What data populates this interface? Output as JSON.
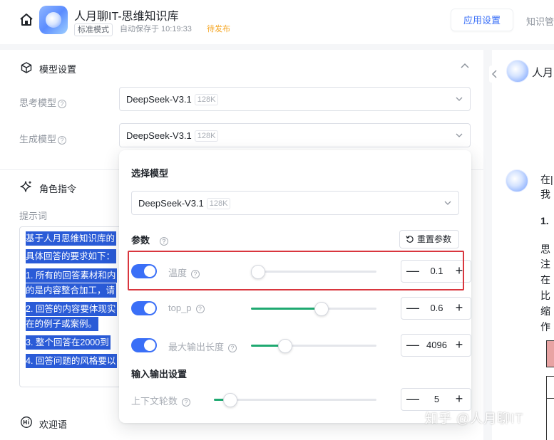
{
  "header": {
    "app_title": "人月聊IT-思维知识库",
    "tag_mode": "标准模式",
    "tag_autosave": "自动保存于 10:19:33",
    "tag_status": "待发布",
    "tab_app_settings": "应用设置",
    "tab_knowledge": "知识管"
  },
  "model_section": {
    "title": "模型设置",
    "think_label": "思考模型",
    "think_model": "DeepSeek-V3.1",
    "think_ctx": "128K",
    "gen_label": "生成模型",
    "gen_model": "DeepSeek-V3.1",
    "gen_ctx": "128K"
  },
  "role_section": {
    "title": "角色指令",
    "prompt_label": "提示词",
    "prompt_lines": [
      "基于人月思维知识库的",
      "具体回答的要求如下：",
      "1. 所有的回答素材和内",
      "的是内容整合加工，请",
      "2. 回答的内容要体现实",
      "在的例子或案例。",
      "3. 整个回答在2000到",
      "4. 回答问题的风格要以"
    ]
  },
  "welcome_section": {
    "title": "欢迎语"
  },
  "popover": {
    "select_model_title": "选择模型",
    "model_value": "DeepSeek-V3.1",
    "model_ctx": "128K",
    "params_title": "参数",
    "reset_label": "重置参数",
    "params": [
      {
        "label": "温度",
        "enabled": true,
        "value": "0.1",
        "fill_fraction": 0.0
      },
      {
        "label": "top_p",
        "enabled": true,
        "value": "0.6",
        "fill_fraction": 0.56
      },
      {
        "label": "最大输出长度",
        "enabled": true,
        "value": "4096",
        "fill_fraction": 0.27
      }
    ],
    "io_title": "输入输出设置",
    "context_rounds": {
      "label": "上下文轮数",
      "value": "5",
      "fill_fraction": 0.1
    }
  },
  "right_panel": {
    "bot_name": "人月",
    "lines": [
      "在|",
      "我",
      "1.",
      "思",
      "注",
      "在",
      "比",
      "缩",
      "作"
    ]
  },
  "watermark": "知乎 @人月聊IT",
  "colors": {
    "accent": "#3a6ff7",
    "slider_green": "#1fa971",
    "highlight_red": "#d9363e",
    "selection_blue": "#2a5bd7",
    "pending_orange": "#f5a623"
  },
  "icons": [
    "home-icon",
    "cube-icon",
    "sparkle-icon",
    "help-icon",
    "chevron-up-icon",
    "chevron-down-icon",
    "reset-icon",
    "chevron-left-icon",
    "hi-icon"
  ]
}
